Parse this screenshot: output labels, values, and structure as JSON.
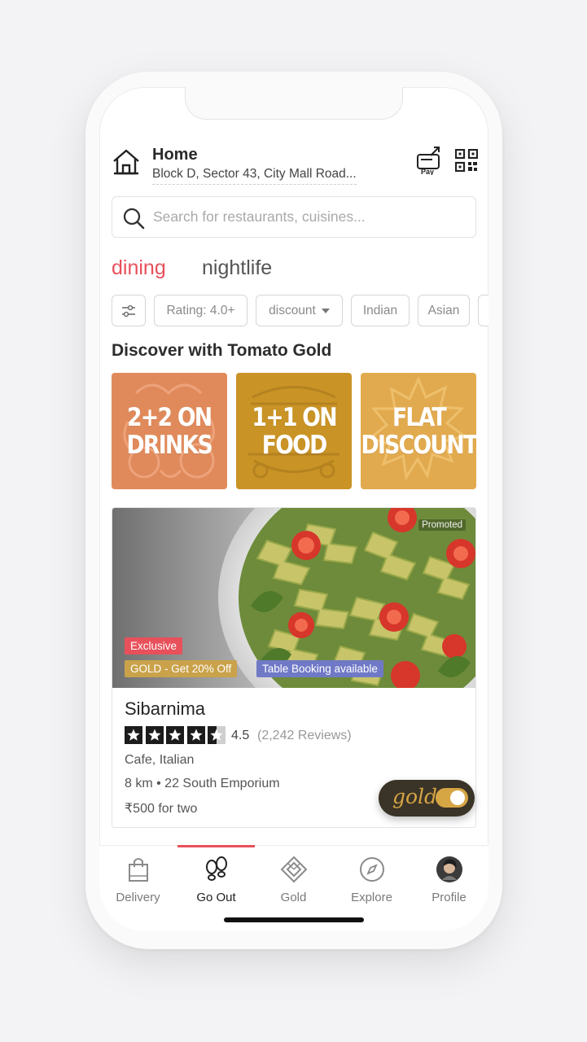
{
  "location": {
    "title": "Home",
    "address": "Block D, Sector 43, City Mall Road..."
  },
  "header_icons": [
    "pay-icon",
    "qr-code-icon"
  ],
  "pay_label": "Pay",
  "search": {
    "placeholder": "Search for restaurants, cuisines..."
  },
  "tabs": [
    {
      "label": "dining",
      "active": true
    },
    {
      "label": "nightlife",
      "active": false
    }
  ],
  "filters": [
    {
      "type": "icon",
      "icon": "sliders-icon"
    },
    {
      "label": "Rating: 4.0+"
    },
    {
      "label": "discount",
      "dropdown": true
    },
    {
      "label": "Indian"
    },
    {
      "label": "Asian"
    }
  ],
  "discover": {
    "title": "Discover with Tomato Gold",
    "cards": [
      {
        "line1": "2+2 ON",
        "line2": "DRINKS",
        "color": "#e08a5b"
      },
      {
        "line1": "1+1 ON",
        "line2": "FOOD",
        "color": "#c99325"
      },
      {
        "line1": "FLAT",
        "line2": "DISCOUNT",
        "color": "#e2aa4f"
      }
    ]
  },
  "restaurant": {
    "promoted": "Promoted",
    "badges": {
      "exclusive": "Exclusive",
      "gold": "GOLD - Get 20% Off",
      "table": "Table Booking available"
    },
    "name": "Sibarnima",
    "rating": "4.5",
    "rating_value": 4.5,
    "reviews": "(2,242 Reviews)",
    "cuisine": "Cafe, Italian",
    "distance": "8 km • 22 South Emporium",
    "price": "₹500 for two"
  },
  "gold_toggle": {
    "label": "gold",
    "on": true
  },
  "nav": [
    {
      "label": "Delivery",
      "icon": "shopping-bag-icon",
      "active": false
    },
    {
      "label": "Go Out",
      "icon": "footprints-icon",
      "active": true
    },
    {
      "label": "Gold",
      "icon": "gold-diamond-icon",
      "active": false
    },
    {
      "label": "Explore",
      "icon": "compass-icon",
      "active": false
    },
    {
      "label": "Profile",
      "icon": "avatar",
      "active": false
    }
  ],
  "colors": {
    "accent": "#e8505b",
    "gold": "#d6a544",
    "table_badge": "#6f79c6"
  }
}
